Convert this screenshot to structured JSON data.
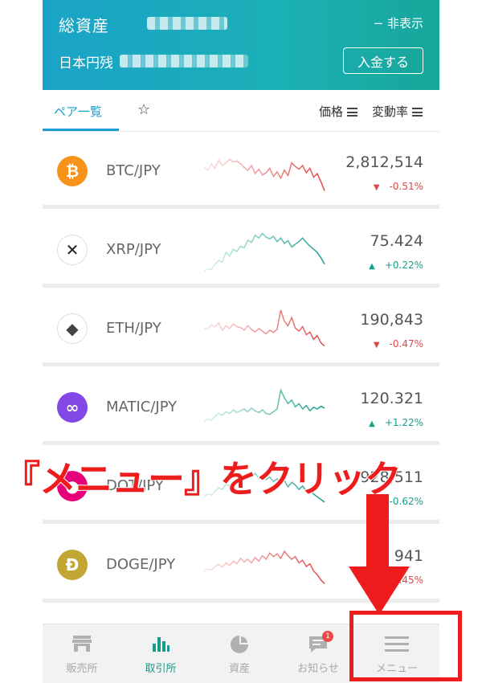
{
  "header": {
    "title": "総資産",
    "hide_label": "− 非表示",
    "yen_label": "日本円残",
    "deposit_button": "入金する"
  },
  "tabs": {
    "pairs_tab": "ペア一覧",
    "star_tab": "☆",
    "sort_price": "価格",
    "sort_change": "変動率"
  },
  "rows": [
    {
      "pair": "BTC/JPY",
      "price": "2,812,514",
      "change": "-0.51%",
      "direction": "down",
      "icon": "bitcoin-icon",
      "glyph": "₿",
      "color": "#f7931a",
      "trend": [
        0.62,
        0.55,
        0.7,
        0.6,
        0.78,
        0.66,
        0.72,
        0.8,
        0.74,
        0.76,
        0.7,
        0.62,
        0.55,
        0.66,
        0.48,
        0.58,
        0.45,
        0.5,
        0.6,
        0.42,
        0.52,
        0.38,
        0.56,
        0.44,
        0.72,
        0.64,
        0.58,
        0.66,
        0.5,
        0.6,
        0.4,
        0.48,
        0.3,
        0.1
      ]
    },
    {
      "pair": "XRP/JPY",
      "price": "75.424",
      "change": "+0.22%",
      "direction": "up",
      "icon": "xrp-icon",
      "glyph": "✕",
      "color": "#222222",
      "trend": [
        0.05,
        0.12,
        0.1,
        0.22,
        0.3,
        0.26,
        0.48,
        0.4,
        0.55,
        0.5,
        0.62,
        0.58,
        0.75,
        0.7,
        0.86,
        0.8,
        0.9,
        0.82,
        0.78,
        0.84,
        0.72,
        0.8,
        0.68,
        0.74,
        0.6,
        0.66,
        0.72,
        0.8,
        0.7,
        0.62,
        0.55,
        0.48,
        0.36,
        0.22
      ]
    },
    {
      "pair": "ETH/JPY",
      "price": "190,843",
      "change": "-0.47%",
      "direction": "down",
      "icon": "ethereum-icon",
      "glyph": "◆",
      "color": "#444444",
      "trend": [
        0.55,
        0.52,
        0.62,
        0.58,
        0.66,
        0.5,
        0.6,
        0.54,
        0.64,
        0.58,
        0.56,
        0.5,
        0.6,
        0.52,
        0.46,
        0.54,
        0.48,
        0.42,
        0.5,
        0.45,
        0.52,
        0.95,
        0.7,
        0.6,
        0.78,
        0.55,
        0.48,
        0.58,
        0.4,
        0.46,
        0.3,
        0.38,
        0.22,
        0.15
      ]
    },
    {
      "pair": "MATIC/JPY",
      "price": "120.321",
      "change": "+1.22%",
      "direction": "up",
      "icon": "polygon-icon",
      "glyph": "∞",
      "color": "#8247e5",
      "trend": [
        0.22,
        0.28,
        0.25,
        0.34,
        0.4,
        0.36,
        0.44,
        0.4,
        0.48,
        0.42,
        0.46,
        0.5,
        0.44,
        0.52,
        0.46,
        0.42,
        0.48,
        0.4,
        0.38,
        0.44,
        0.5,
        0.92,
        0.75,
        0.62,
        0.7,
        0.55,
        0.62,
        0.5,
        0.58,
        0.46,
        0.54,
        0.5,
        0.56,
        0.52
      ]
    },
    {
      "pair": "DOT/JPY",
      "price": "928,511",
      "change": "-0.62%",
      "direction": "up",
      "icon": "polkadot-icon",
      "glyph": "●",
      "color": "#e6007a",
      "trend": [
        0.3,
        0.36,
        0.34,
        0.42,
        0.5,
        0.46,
        0.58,
        0.54,
        0.62,
        0.7,
        0.66,
        0.74,
        0.8,
        0.76,
        0.82,
        0.72,
        0.78,
        0.68,
        0.74,
        0.64,
        0.7,
        0.58,
        0.66,
        0.52,
        0.62,
        0.56,
        0.46,
        0.54,
        0.42,
        0.48,
        0.36,
        0.3,
        0.24,
        0.18
      ]
    },
    {
      "pair": "DOGE/JPY",
      "price": "941",
      "change": "-0.45%",
      "direction": "down",
      "icon": "dogecoin-icon",
      "glyph": "Ð",
      "color": "#c2a633",
      "trend": [
        0.4,
        0.45,
        0.42,
        0.5,
        0.55,
        0.48,
        0.58,
        0.52,
        0.62,
        0.56,
        0.68,
        0.6,
        0.66,
        0.58,
        0.7,
        0.62,
        0.74,
        0.66,
        0.8,
        0.72,
        0.78,
        0.68,
        0.84,
        0.74,
        0.66,
        0.72,
        0.58,
        0.64,
        0.5,
        0.56,
        0.4,
        0.32,
        0.2,
        0.12
      ]
    }
  ],
  "annotation": "『メニュー』をクリック",
  "bottom_nav": [
    {
      "label": "販売所",
      "icon": "store-icon"
    },
    {
      "label": "取引所",
      "icon": "bar-chart-icon",
      "active": true
    },
    {
      "label": "資産",
      "icon": "pie-chart-icon"
    },
    {
      "label": "お知らせ",
      "icon": "notification-icon",
      "badge": "1"
    },
    {
      "label": "メニュー",
      "icon": "hamburger-menu-icon"
    }
  ],
  "colors": {
    "up": "#16a08c",
    "down": "#e04646",
    "accent": "#1a9fd2",
    "annotation": "#ee1c1c"
  }
}
